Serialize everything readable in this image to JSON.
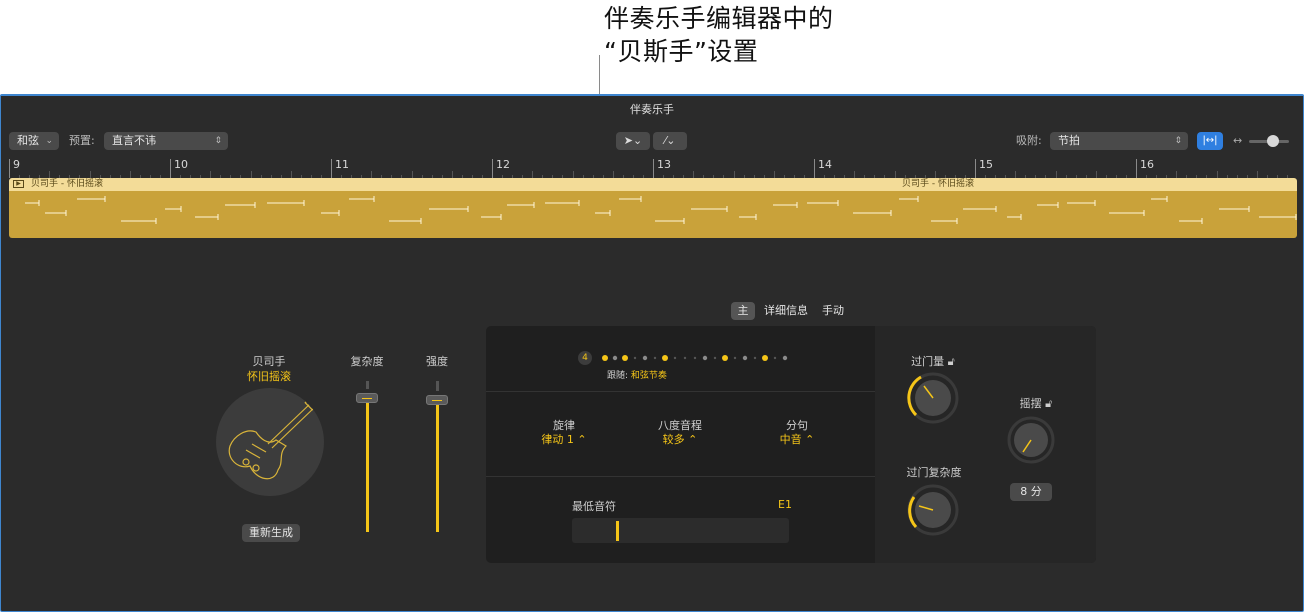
{
  "callout": {
    "line1": "伴奏乐手编辑器中的",
    "line2": "“贝斯手”设置"
  },
  "window": {
    "title": "伴奏乐手"
  },
  "toolbar": {
    "chord_button": "和弦",
    "preset_label": "预置:",
    "preset_value": "直言不讳",
    "snap_label": "吸附:",
    "snap_value": "节拍"
  },
  "ruler": {
    "bars": [
      "9",
      "10",
      "11",
      "12",
      "13",
      "14",
      "15",
      "16"
    ]
  },
  "region": {
    "title_a": "贝司手 - 怀旧摇滚",
    "title_b": "贝司手 - 怀旧摇滚",
    "color": "#c9a23a"
  },
  "bassist": {
    "name": "贝司手",
    "style": "怀旧摇滚",
    "regenerate": "重新生成"
  },
  "sliders": {
    "complexity": {
      "label": "复杂度",
      "level": 0.96
    },
    "intensity": {
      "label": "强度",
      "level": 0.95
    }
  },
  "tabs": {
    "main": "主",
    "details": "详细信息",
    "manual": "手动"
  },
  "beats": {
    "count": "4",
    "follow_label": "跟随:",
    "follow_value": "和弦节奏"
  },
  "params": {
    "melody": {
      "label": "旋律",
      "value": "律动 1 ⌃"
    },
    "octave": {
      "label": "八度音程",
      "value": "较多 ⌃"
    },
    "phrasing": {
      "label": "分句",
      "value": "中音 ⌃"
    }
  },
  "lowest_note": {
    "label": "最低音符",
    "value": "E1"
  },
  "fills": {
    "label": "过门量",
    "level": 0.35
  },
  "fill_complexity": {
    "label": "过门复杂度",
    "level": 0.3
  },
  "swing": {
    "label": "摇摆",
    "value": "8 分"
  },
  "accent": "#f5c518"
}
